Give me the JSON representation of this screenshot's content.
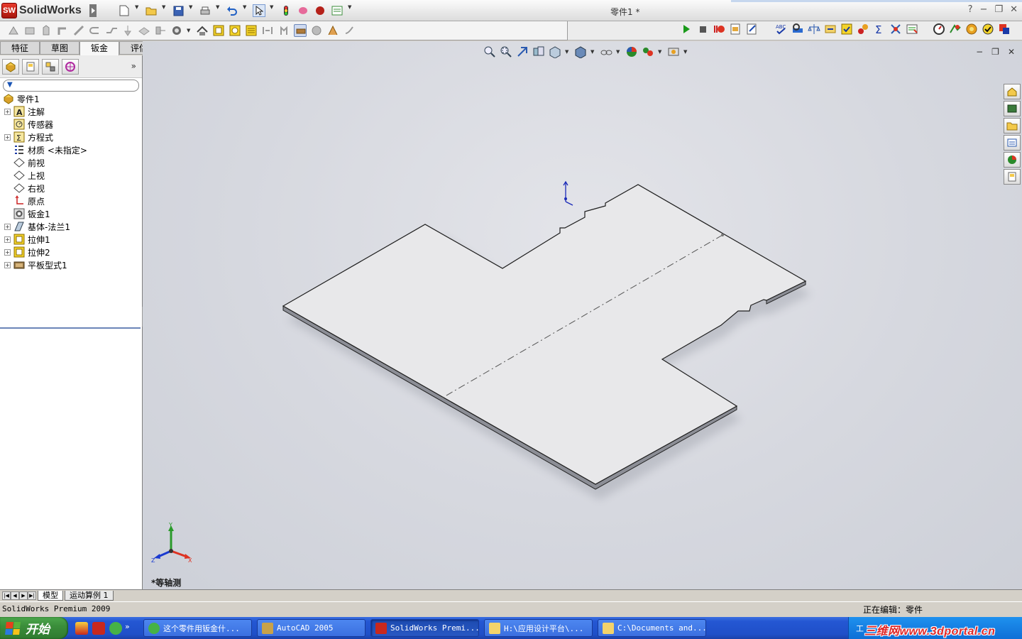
{
  "app": {
    "logo_text": "SolidWorks",
    "logo_badge": "SW",
    "document_title": "零件1 *",
    "window_controls": [
      "?",
      "−",
      "❐",
      "✕"
    ]
  },
  "tabs": [
    {
      "label": "特征",
      "active": false
    },
    {
      "label": "草图",
      "active": false
    },
    {
      "label": "钣金",
      "active": true
    },
    {
      "label": "评估",
      "active": false
    }
  ],
  "panel": {
    "more_label": "»",
    "tree": [
      {
        "label": "零件1",
        "expander": "",
        "icon": "part-icon",
        "root": true
      },
      {
        "label": "注解",
        "expander": "+",
        "icon": "annotation-icon"
      },
      {
        "label": "传感器",
        "expander": "",
        "icon": "sensor-icon"
      },
      {
        "label": "方程式",
        "expander": "+",
        "icon": "equation-icon"
      },
      {
        "label": "材质 <未指定>",
        "expander": "",
        "icon": "material-icon"
      },
      {
        "label": "前视",
        "expander": "",
        "icon": "plane-icon"
      },
      {
        "label": "上视",
        "expander": "",
        "icon": "plane-icon"
      },
      {
        "label": "右视",
        "expander": "",
        "icon": "plane-icon"
      },
      {
        "label": "原点",
        "expander": "",
        "icon": "origin-icon"
      },
      {
        "label": "钣金1",
        "expander": "",
        "icon": "sheetmetal-icon"
      },
      {
        "label": "基体-法兰1",
        "expander": "+",
        "icon": "base-flange-icon"
      },
      {
        "label": "拉伸1",
        "expander": "+",
        "icon": "extrude-icon"
      },
      {
        "label": "拉伸2",
        "expander": "+",
        "icon": "extrude-icon"
      },
      {
        "label": "平板型式1",
        "expander": "+",
        "icon": "flat-pattern-icon"
      }
    ]
  },
  "viewport": {
    "view_label": "*等轴测",
    "triad": {
      "x": "X",
      "y": "Y",
      "z": "Z"
    },
    "controls": [
      "−",
      "❐",
      "✕"
    ]
  },
  "bottom_tabs": [
    "模型",
    "运动算例 1"
  ],
  "status": {
    "app_version": "SolidWorks Premium 2009",
    "editing": "正在编辑：零件"
  },
  "taskbar": {
    "start_label": "开始",
    "more": "»",
    "tasks": [
      {
        "label": "这个零件用钣金什...",
        "icon_color": "#46b246",
        "active": false
      },
      {
        "label": "AutoCAD 2005",
        "icon_color": "#c8a24a",
        "active": false
      },
      {
        "label": "SolidWorks Premi...",
        "icon_color": "#c8281e",
        "active": true
      },
      {
        "label": "H:\\应用设计平台\\...",
        "icon_color": "#f3d36b",
        "active": false
      },
      {
        "label": "C:\\Documents and...",
        "icon_color": "#f3d36b",
        "active": false
      }
    ],
    "tray_text": "工"
  },
  "watermark": "三维网www.3dportal.cn",
  "colors": {
    "viewport_bg": "#d6d8df",
    "part_top": "#e6e6e8",
    "part_edge": "#2a2a2a",
    "taskbar_blue": "#2457d3",
    "start_green": "#3b8e3b"
  }
}
